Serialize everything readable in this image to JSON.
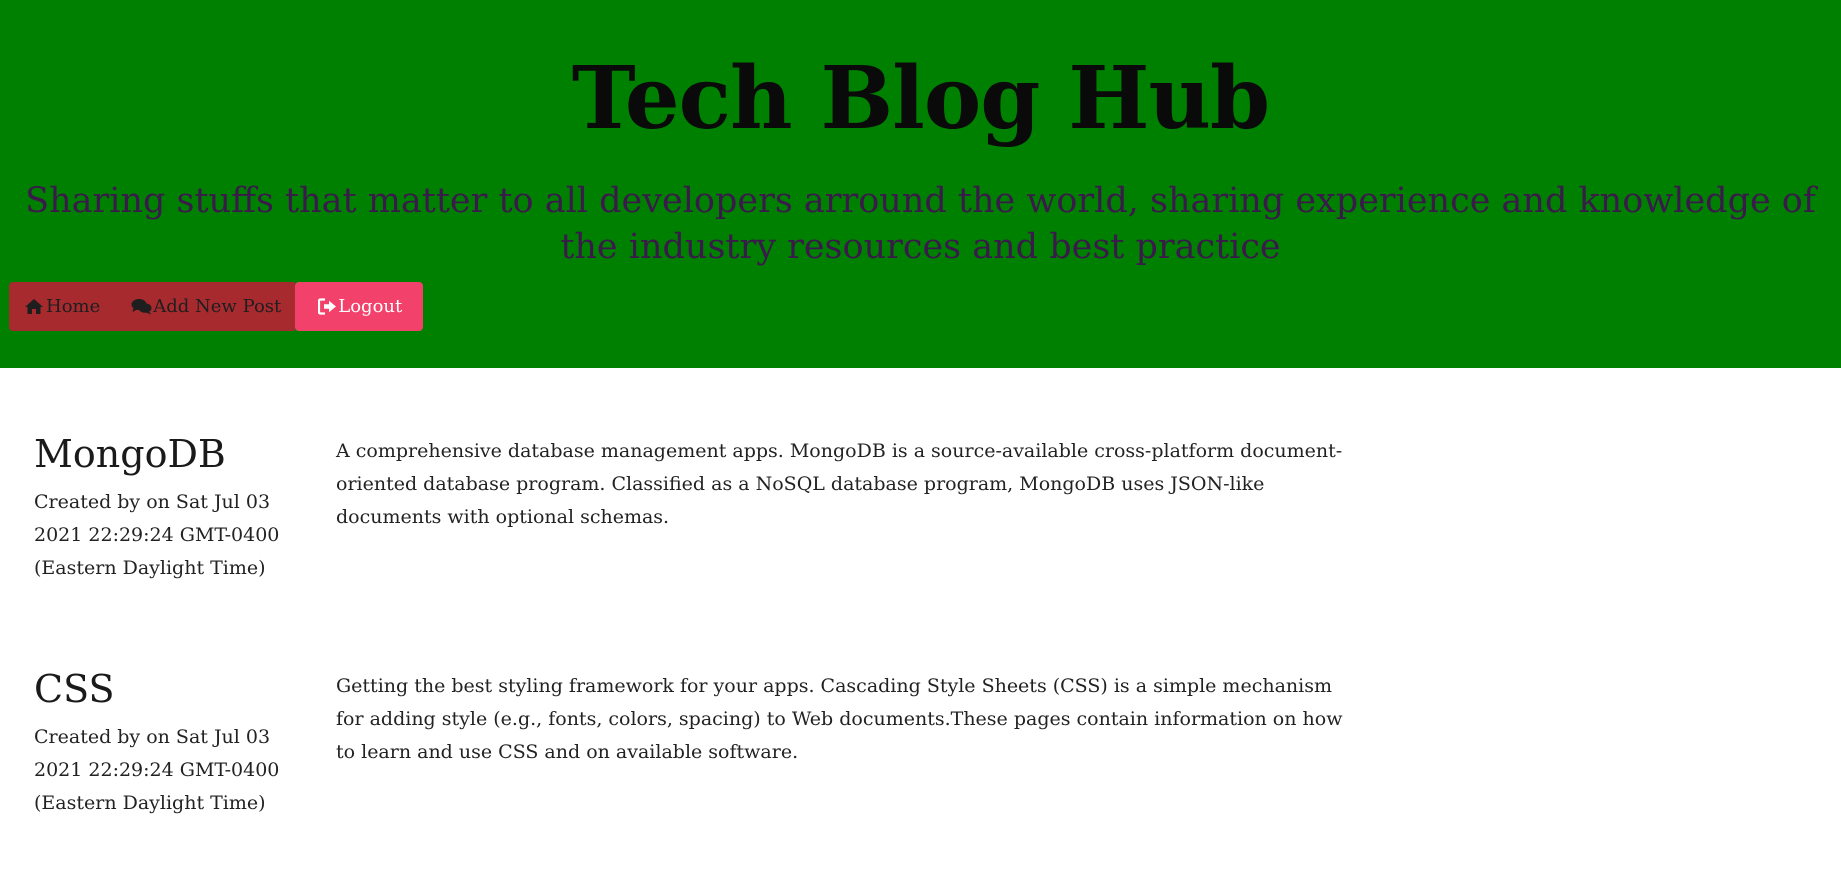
{
  "header": {
    "title": "Tech Blog Hub",
    "subtitle": "Sharing stuffs that matter to all developers arround the world, sharing experience and knowledge of the industry resources and best practice",
    "background_color": "#008000"
  },
  "nav": {
    "home_label": "Home",
    "home_icon": "home-icon",
    "add_post_label": "Add New Post",
    "add_post_icon": "comments-icon",
    "logout_label": "Logout",
    "logout_icon": "sign-out-icon",
    "nav_color": "#a72a2f",
    "logout_color": "#f2416b"
  },
  "posts": [
    {
      "title": "MongoDB",
      "meta": "Created by on Sat Jul 03 2021 22:29:24 GMT-0400 (Eastern Daylight Time)",
      "body": "A comprehensive database management apps. MongoDB is a source-available cross-platform document-oriented database program. Classified as a NoSQL database program, MongoDB uses JSON-like documents with optional schemas."
    },
    {
      "title": "CSS",
      "meta": "Created by on Sat Jul 03 2021 22:29:24 GMT-0400 (Eastern Daylight Time)",
      "body": "Getting the best styling framework for your apps. Cascading Style Sheets (CSS) is a simple mechanism for adding style (e.g., fonts, colors, spacing) to Web documents.These pages contain information on how to learn and use CSS and on available software."
    }
  ]
}
